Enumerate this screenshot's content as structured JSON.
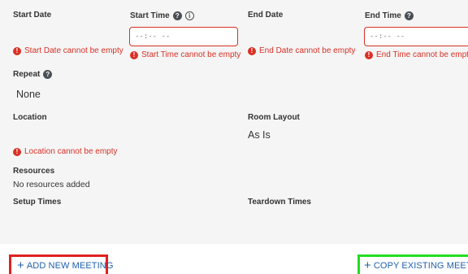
{
  "form": {
    "start_date": {
      "label": "Start Date",
      "error": "Start Date cannot be empty"
    },
    "start_time": {
      "label": "Start Time",
      "placeholder": "--:-- --",
      "error": "Start Time cannot be empty"
    },
    "end_date": {
      "label": "End Date",
      "error": "End Date cannot be empty"
    },
    "end_time": {
      "label": "End Time",
      "placeholder": "--:-- --",
      "error": "End Time cannot be empty"
    },
    "repeat": {
      "label": "Repeat",
      "value": "None"
    },
    "location": {
      "label": "Location",
      "error": "Location cannot be empty"
    },
    "room_layout": {
      "label": "Room Layout",
      "value": "As Is"
    },
    "resources": {
      "label": "Resources",
      "value": "No resources added"
    },
    "setup_times": {
      "label": "Setup Times"
    },
    "teardown_times": {
      "label": "Teardown Times"
    }
  },
  "actions": {
    "add_new_meeting": "ADD NEW MEETING",
    "copy_existing_meeting": "COPY EXISTING MEETING"
  },
  "icons": {
    "error": "exclamation-circle-icon",
    "help": "question-circle-icon",
    "info": "info-circle-icon",
    "plus": "plus-icon"
  },
  "colors": {
    "error": "#d93025",
    "link": "#1f5fae",
    "highlight_red": "#e02020",
    "highlight_green": "#22dd22"
  }
}
